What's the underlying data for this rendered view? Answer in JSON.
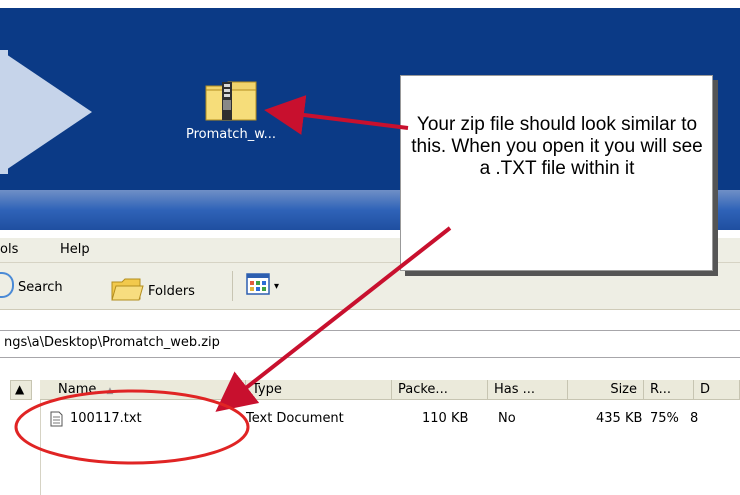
{
  "desktop": {
    "zip_icon": "zip-folder-icon",
    "zip_label": "Promatch_w..."
  },
  "callout": {
    "text": "Your zip file should look similar to this.  When you open it you will see a .TXT file within it"
  },
  "explorer": {
    "menu": [
      "ols",
      "Help"
    ],
    "toolbar": {
      "search_label": "Search",
      "folders_label": "Folders"
    },
    "address": "ngs\\a\\Desktop\\Promatch_web.zip",
    "columns": [
      "Name",
      "Type",
      "Packe...",
      "Has ...",
      "Size",
      "R...",
      "D"
    ],
    "files": [
      {
        "name": "100117.txt",
        "type": "Text Document",
        "packed": "110 KB",
        "has_password": "No",
        "size": "435 KB",
        "ratio": "75%",
        "extra": "8"
      }
    ]
  },
  "colors": {
    "desktop_bg": "#0b3a86",
    "arrow": "#c8102e",
    "callout_bg": "#ffffff"
  }
}
